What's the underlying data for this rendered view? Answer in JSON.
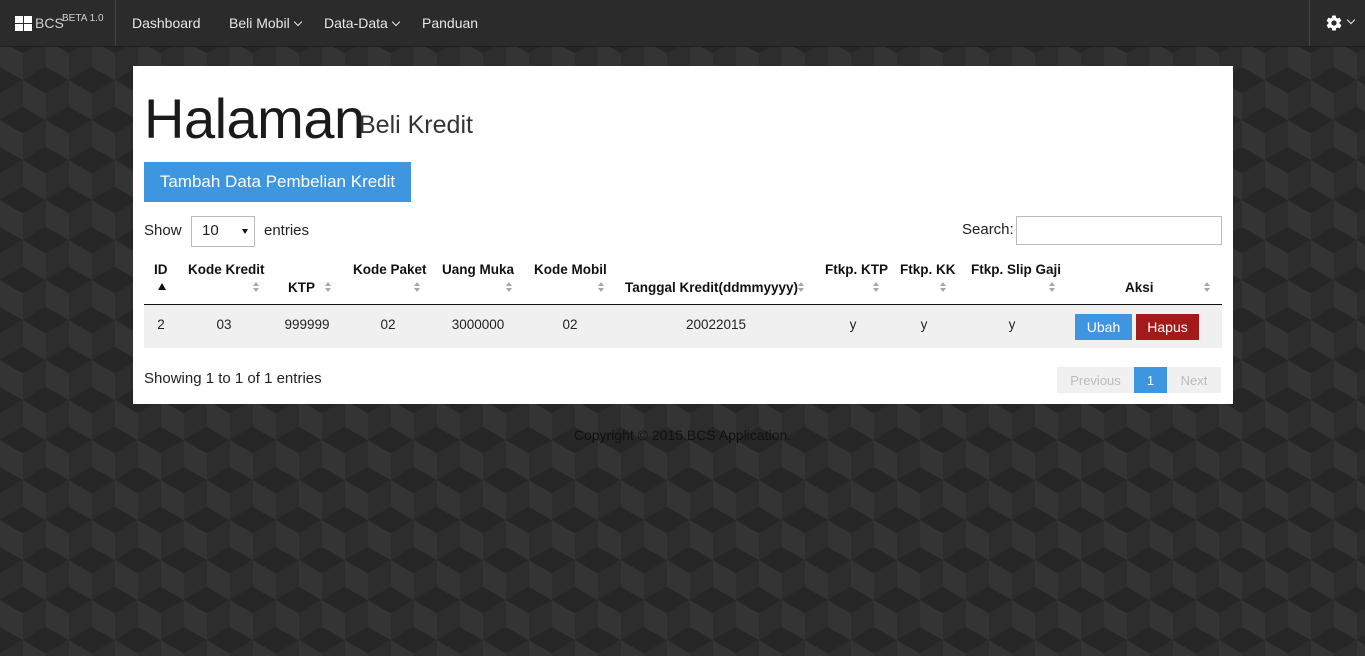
{
  "navbar": {
    "brand": "BCS",
    "beta": "BETA 1.0",
    "items": [
      {
        "label": "Dashboard"
      },
      {
        "label": "Beli Mobil"
      },
      {
        "label": "Data-Data"
      },
      {
        "label": "Panduan"
      }
    ],
    "settings_icon": "gear-icon"
  },
  "page": {
    "title": "Halaman",
    "subtitle": "Beli Kredit",
    "add_button": "Tambah Data Pembelian Kredit"
  },
  "table_controls": {
    "show_label": "Show",
    "entries_value": "10",
    "entries_label": "entries",
    "search_label": "Search:",
    "search_value": ""
  },
  "table": {
    "columns": [
      {
        "line1": "ID",
        "line2": ""
      },
      {
        "line1": "Kode Kredit",
        "line2": ""
      },
      {
        "line1": "KTP",
        "line2": ""
      },
      {
        "line1": "Kode Paket",
        "line2": ""
      },
      {
        "line1": "Uang Muka",
        "line2": ""
      },
      {
        "line1": "Kode Mobil",
        "line2": ""
      },
      {
        "line1": "Tanggal Kredit(ddmmyyyy)",
        "line2": ""
      },
      {
        "line1": "Ftkp. KTP",
        "line2": ""
      },
      {
        "line1": "Ftkp. KK",
        "line2": ""
      },
      {
        "line1": "Ftkp. Slip Gaji",
        "line2": ""
      },
      {
        "line1": "Aksi",
        "line2": ""
      }
    ],
    "rows": [
      {
        "cells": [
          "2",
          "03",
          "999999",
          "02",
          "3000000",
          "02",
          "20022015",
          "y",
          "y",
          "y"
        ],
        "edit_label": "Ubah",
        "delete_label": "Hapus"
      }
    ]
  },
  "info": "Showing 1 to 1 of 1 entries",
  "pagination": {
    "previous": "Previous",
    "current": "1",
    "next": "Next"
  },
  "footer": "Copyright © 2015 BCS Application."
}
